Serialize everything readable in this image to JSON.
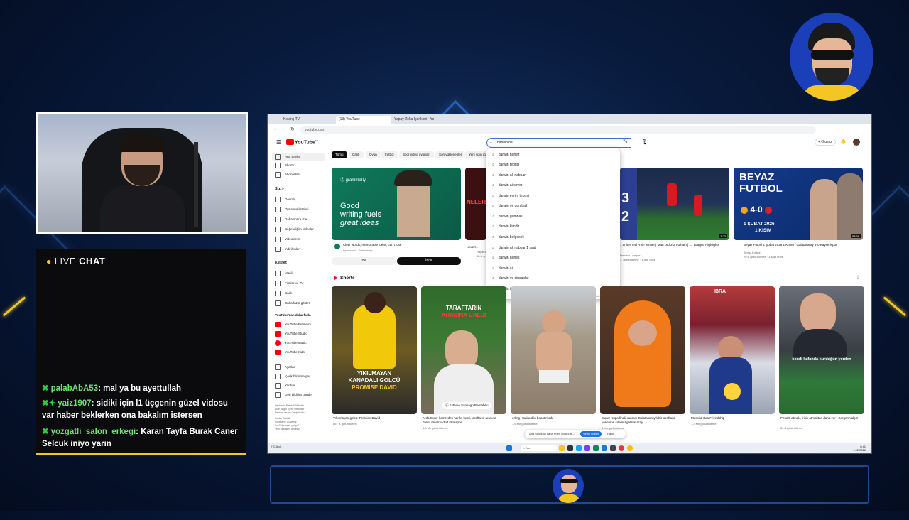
{
  "chat": {
    "header_live": "LIVE",
    "header_chat": "CHAT",
    "messages": [
      {
        "user": "palabAbA53",
        "text": ": mal ya bu ayettullah"
      },
      {
        "user": "yaiz1907",
        "text": ": sidiki için l1 üçgenin güzel vidosu var haber beklerken ona bakalım istersen"
      },
      {
        "user": "yozgatli_salon_erkegi",
        "text": ": Karan Tayfa Burak Caner Selcuk iniyo yarın"
      }
    ]
  },
  "browser": {
    "tabs": [
      "Kıvanç TV",
      "(13) YouTube",
      "Yapay Zeka İçerikleri - Yo"
    ],
    "url": "youtube.com"
  },
  "youtube": {
    "logo": "YouTube",
    "logo_suffix": "TR",
    "search_value": "darwin ne",
    "create_label": "+ Oluştur",
    "sidebar": {
      "main": [
        "Ana Sayfa",
        "Shorts",
        "Abonelikler"
      ],
      "you_header": "Siz >",
      "you": [
        "Geçmiş",
        "Oynatma listeleri",
        "Daha sonra izle",
        "Beğendiğim videolar",
        "Videolarım",
        "İndirilenler"
      ],
      "explore_header": "Keşfet",
      "explore": [
        "Müzik",
        "Filmler ve TV",
        "Canlı",
        "Daha fazla göster"
      ],
      "more_header": "YouTube'dan daha fazla",
      "more": [
        "YouTube Premium",
        "YouTube Studio",
        "YouTube Music",
        "YouTube Kids"
      ],
      "settings": [
        "Ayarlar",
        "İçerik bildirme geç...",
        "Yardım",
        "Geri bildirim gönder"
      ],
      "footer": [
        "Hakkında  Basın  Telif hakkı",
        "Bize ulaşın  İçerik Üreticiler",
        "Reklam verme  Geliştiriciler",
        "Şartlar  Gizlilik",
        "Politika ve Güvenlik",
        "YouTube nasıl çalışır?",
        "Yeni özellikleri deneyin"
      ]
    },
    "chips": [
      "Tümü",
      "Canlı",
      "Oyun",
      "Futbol",
      "Spor video oyunları",
      "Son yüklenenler",
      "Yeni sizin için"
    ],
    "videos": [
      {
        "title": "Clear words, memorable ideas, can't lose",
        "channel": "Sponsorlu · Grammarly",
        "thumb_text_1": "Good",
        "thumb_text_2": "writing fuels",
        "thumb_text_3": "great ideas",
        "brand": "grammarly",
        "action_1": "İzle",
        "action_2": "İndir"
      },
      {
        "title": "NELER...",
        "channel": "Hayat Bi...",
        "meta": "48 B g..."
      },
      {
        "title": "...unites 94th-min winner | Man Utd 3-2 Fulham | ...r League Highlights",
        "channel": "Premier League",
        "meta": "... görüntüleme · 1 gün önce",
        "duration": "3:22"
      },
      {
        "title": "Beyaz Futbol 1 Şubat 2026 1.Kısım / Galatasaray 4-0 Kayserispor",
        "channel": "Beyaz Futbol",
        "meta": "29 B görüntüleme · 1 saat önce",
        "thumb_title": "BEYAZ FUTBOL",
        "score": "4-0",
        "date_line": "1 ŞUBAT 2026",
        "part": "1.KISIM",
        "duration": "53:58"
      }
    ],
    "suggestions": [
      "darwin nunez",
      "darwin teorisi",
      "darwin ali nabbar",
      "darwin ai cover",
      "darwin evrim teorisi",
      "darwin ve gumball",
      "darwin gumball",
      "darwin kimdir",
      "darwin belgeseli",
      "darwin ali nabbar 1 saat",
      "darwin nunes",
      "darwin ai",
      "darwin ve sincaplar",
      "darwin türkçe"
    ],
    "suggestions_footer": "Arama tahminlerini bildir",
    "shorts_header": "Shorts",
    "shorts": [
      {
        "title": "Yıkılmayan golcü: Promise David",
        "views": "867 B görüntüleme",
        "ov1": "YIKILMAYAN",
        "ov2": "KANADALI GOLCÜ",
        "ov3": "PROMISE DAVID"
      },
      {
        "title": "Arda Güler kemerden hariks kesti, taraftarın arasına daldı. #realmadrid #mbappe ...",
        "views": "5,6 Mn görüntüleme",
        "ov1": "TARAFTARIN",
        "ov2": "ARASINA DALDI",
        "loc": "Estadio Santiago Bernabéu"
      },
      {
        "title": "erling Haaland in beast mode",
        "views": "7,6 Mn görüntüleme"
      },
      {
        "title": "Süper Kupa finali sonrası Galatasaray'lı bir taraftarın yönetime sitemi #galatasaray ...",
        "views": "3 Mn görüntüleme"
      },
      {
        "title": "Messi & Ibra Friendship",
        "views": "7,3 Mn görüntüleme",
        "ov1": "IBRA"
      },
      {
        "title": "Penaltı atmak, frikik atmaktan daha zor | Sergen Yalçın",
        "views": "34 B görüntüleme",
        "ov1": "kendi kafanda kurduğun yerden"
      }
    ],
    "toast_text": "Ana Sayfa'da daha iyi bir görünüm...",
    "toast_btn": "Şimdi göster",
    "toast_no": "Hayır"
  },
  "taskbar": {
    "search": "Ara",
    "time": "0:41",
    "date": "1.02.2026",
    "weather": "2°C Açık"
  }
}
